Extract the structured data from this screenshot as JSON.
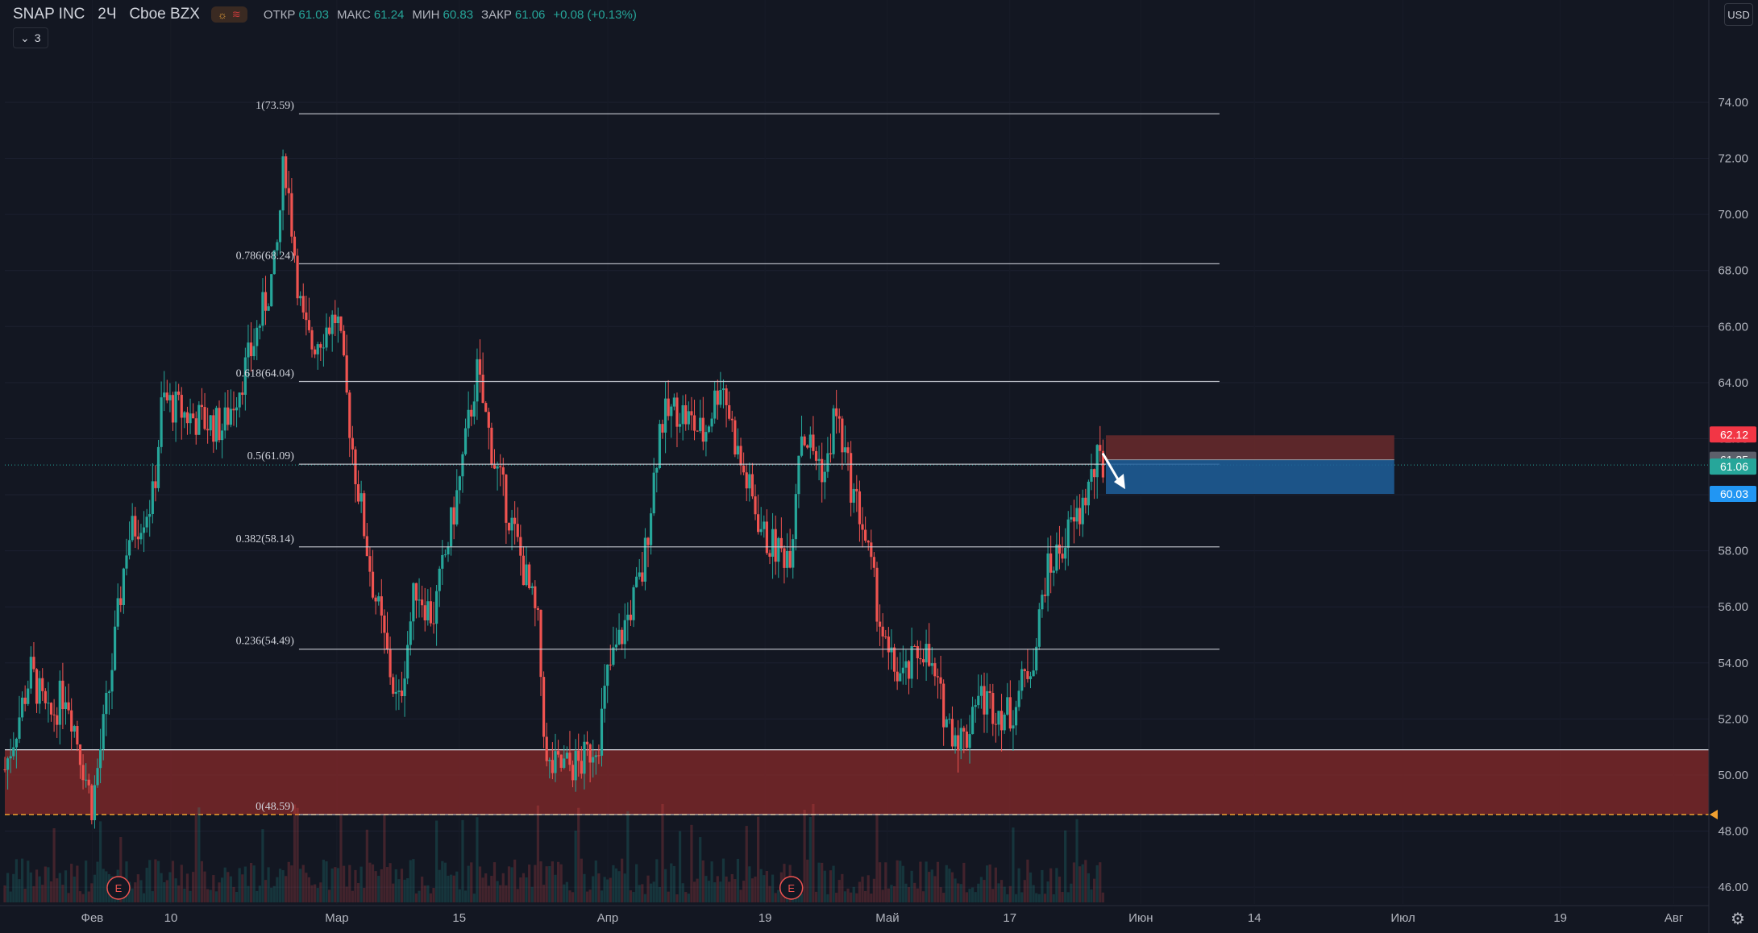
{
  "header": {
    "symbol": "SNAP INC",
    "interval": "2Ч",
    "exchange": "Cboe BZX",
    "indicator_count": "3",
    "ohlc": [
      {
        "label": "ОТКР",
        "value": "61.03"
      },
      {
        "label": "МАКС",
        "value": "61.24"
      },
      {
        "label": "МИН",
        "value": "60.83"
      },
      {
        "label": "ЗАКР",
        "value": "61.06"
      },
      {
        "label": "",
        "value": "+0.08 (+0.13%)"
      }
    ]
  },
  "currency": "USD",
  "colors": {
    "background": "#131722",
    "up": "#26a69a",
    "down": "#ef5350",
    "zone": "#8a2a2a",
    "stop_zone": "#6a2a2c",
    "target_zone": "#1f5f9a",
    "fib_line": "#d1d4dc",
    "close_badge": "#26a69a",
    "stop_badge": "#f23645",
    "target_badge": "#2196f3",
    "ref_badge": "#5d606b"
  },
  "chart_data": {
    "type": "candlestick",
    "title": "SNAP INC · 2Ч · Cboe BZX",
    "y_axis": {
      "ticks": [
        "74.00",
        "72.00",
        "70.00",
        "68.00",
        "66.00",
        "64.00",
        "62.00",
        "60.00",
        "58.00",
        "56.00",
        "54.00",
        "52.00",
        "50.00",
        "48.00",
        "46.00"
      ],
      "ylim": [
        45.4,
        76.5
      ]
    },
    "x_axis": {
      "labels": [
        "Фев",
        "10",
        "Мар",
        "15",
        "Апр",
        "19",
        "Май",
        "17",
        "Июн",
        "14",
        "Июл",
        "19",
        "Авг"
      ],
      "range": [
        "2021-01-22",
        "2021-08-05"
      ]
    },
    "fibonacci": [
      {
        "label": "1(73.59)",
        "value": 73.59
      },
      {
        "label": "0.786(68.24)",
        "value": 68.24
      },
      {
        "label": "0.618(64.04)",
        "value": 64.04
      },
      {
        "label": "0.5(61.09)",
        "value": 61.09
      },
      {
        "label": "0.382(58.14)",
        "value": 58.14
      },
      {
        "label": "0.236(54.49)",
        "value": 54.49
      },
      {
        "label": "0(48.59)",
        "value": 48.59
      }
    ],
    "support_zone": {
      "from": 48.59,
      "to": 50.9
    },
    "short_position": {
      "entry": 61.25,
      "stop": 62.12,
      "target": 60.03,
      "start": "2021-05-28",
      "end": "2021-06-30"
    },
    "price_badges": [
      {
        "label": "62.12",
        "role": "stop"
      },
      {
        "label": "61.25",
        "role": "ref"
      },
      {
        "label": "61.06",
        "role": "close"
      },
      {
        "label": "60.03",
        "role": "target"
      }
    ],
    "earnings_markers": [
      {
        "label": "E",
        "date": "2021-02-04"
      },
      {
        "label": "E",
        "date": "2021-04-22"
      }
    ],
    "price_path": [
      {
        "date": "2021-01-22",
        "close": 50.2
      },
      {
        "date": "2021-01-25",
        "close": 53.7
      },
      {
        "date": "2021-01-27",
        "close": 51.9
      },
      {
        "date": "2021-01-29",
        "close": 53.1
      },
      {
        "date": "2021-02-01",
        "close": 48.9
      },
      {
        "date": "2021-02-03",
        "close": 53.2
      },
      {
        "date": "2021-02-05",
        "close": 58.4
      },
      {
        "date": "2021-02-08",
        "close": 59.9
      },
      {
        "date": "2021-02-09",
        "close": 63.4
      },
      {
        "date": "2021-02-12",
        "close": 62.8
      },
      {
        "date": "2021-02-16",
        "close": 62.4
      },
      {
        "date": "2021-02-19",
        "close": 64.9
      },
      {
        "date": "2021-02-22",
        "close": 68.2
      },
      {
        "date": "2021-02-23",
        "close": 72.1
      },
      {
        "date": "2021-02-25",
        "close": 66.2
      },
      {
        "date": "2021-02-26",
        "close": 65.3
      },
      {
        "date": "2021-03-01",
        "close": 66.4
      },
      {
        "date": "2021-03-03",
        "close": 61.1
      },
      {
        "date": "2021-03-05",
        "close": 57.0
      },
      {
        "date": "2021-03-08",
        "close": 52.3
      },
      {
        "date": "2021-03-10",
        "close": 56.8
      },
      {
        "date": "2021-03-12",
        "close": 55.6
      },
      {
        "date": "2021-03-15",
        "close": 60.4
      },
      {
        "date": "2021-03-17",
        "close": 64.4
      },
      {
        "date": "2021-03-19",
        "close": 61.2
      },
      {
        "date": "2021-03-22",
        "close": 57.8
      },
      {
        "date": "2021-03-24",
        "close": 55.3
      },
      {
        "date": "2021-03-25",
        "close": 50.2
      },
      {
        "date": "2021-03-29",
        "close": 50.4
      },
      {
        "date": "2021-03-31",
        "close": 51.4
      },
      {
        "date": "2021-04-01",
        "close": 53.6
      },
      {
        "date": "2021-04-05",
        "close": 57.2
      },
      {
        "date": "2021-04-07",
        "close": 62.6
      },
      {
        "date": "2021-04-09",
        "close": 63.1
      },
      {
        "date": "2021-04-12",
        "close": 62.1
      },
      {
        "date": "2021-04-14",
        "close": 64.2
      },
      {
        "date": "2021-04-16",
        "close": 61.3
      },
      {
        "date": "2021-04-19",
        "close": 58.4
      },
      {
        "date": "2021-04-21",
        "close": 57.9
      },
      {
        "date": "2021-04-22",
        "close": 58.1
      },
      {
        "date": "2021-04-23",
        "close": 62.4
      },
      {
        "date": "2021-04-26",
        "close": 60.7
      },
      {
        "date": "2021-04-27",
        "close": 63.1
      },
      {
        "date": "2021-04-29",
        "close": 60.1
      },
      {
        "date": "2021-04-30",
        "close": 59.2
      },
      {
        "date": "2021-05-03",
        "close": 54.1
      },
      {
        "date": "2021-05-05",
        "close": 53.4
      },
      {
        "date": "2021-05-07",
        "close": 54.7
      },
      {
        "date": "2021-05-10",
        "close": 51.8
      },
      {
        "date": "2021-05-12",
        "close": 51.2
      },
      {
        "date": "2021-05-13",
        "close": 52.9
      },
      {
        "date": "2021-05-17",
        "close": 52.1
      },
      {
        "date": "2021-05-19",
        "close": 53.7
      },
      {
        "date": "2021-05-20",
        "close": 54.6
      },
      {
        "date": "2021-05-21",
        "close": 57.0
      },
      {
        "date": "2021-05-24",
        "close": 58.8
      },
      {
        "date": "2021-05-25",
        "close": 59.3
      },
      {
        "date": "2021-05-26",
        "close": 60.3
      },
      {
        "date": "2021-05-27",
        "close": 61.1
      },
      {
        "date": "2021-05-28",
        "close": 61.06
      }
    ]
  }
}
